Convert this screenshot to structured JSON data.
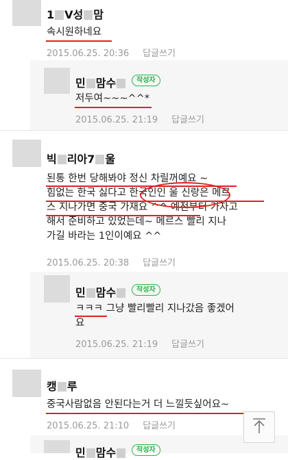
{
  "comments": [
    {
      "author_start": "1",
      "author_mid": "V성",
      "author_end": "맘",
      "lines": [
        "속시원하네요"
      ],
      "date": "2015.06.25. 20:36",
      "reply_label": "답글쓰기"
    },
    {
      "author_start": "민",
      "author_mid": "맘수",
      "author_end": "",
      "badge": "작성자",
      "lines": [
        "저두여~~~^^*"
      ],
      "date": "2015.06.25. 21:19",
      "reply_label": "답글쓰기"
    },
    {
      "author_start": "빅",
      "author_mid": "리아7",
      "author_end": "울",
      "lines": [
        "된통 한번 당해봐야 정신 차릴꺼예요 ~",
        "힘없는 한국 싫다고 한국인인 울 신랑은 메르",
        "스 지나가면 중국 가재요 ^^ 예전부터 가자고",
        "해서 준비하고 있었는데~ 메르스 빨리 지나",
        "가길 바라는 1인이예요 ^^"
      ],
      "date": "2015.06.25. 20:38",
      "reply_label": "답글쓰기"
    },
    {
      "author_start": "민",
      "author_mid": "맘수",
      "author_end": "",
      "badge": "작성자",
      "lines": [
        "ㅋㅋㅋ 그냥 빨리빨리 지나갔음 좋겠어",
        "요"
      ],
      "date": "2015.06.25. 21:19",
      "reply_label": "답글쓰기"
    },
    {
      "author_start": "캥",
      "author_mid": "",
      "author_end": "루",
      "lines": [
        "중국사람없음 안된다는거 더 느낄듯싶어요~"
      ],
      "date": "2015.06.25. 21:10",
      "reply_label": "답글쓰기"
    },
    {
      "author_start": "민",
      "author_mid": "맘수",
      "author_end": "",
      "badge": "작성자"
    }
  ],
  "top_button_icon": "arrow-up-icon",
  "colors": {
    "badge": "#2bb24c",
    "annotation": "#e02020",
    "meta": "#9a9a9a"
  }
}
